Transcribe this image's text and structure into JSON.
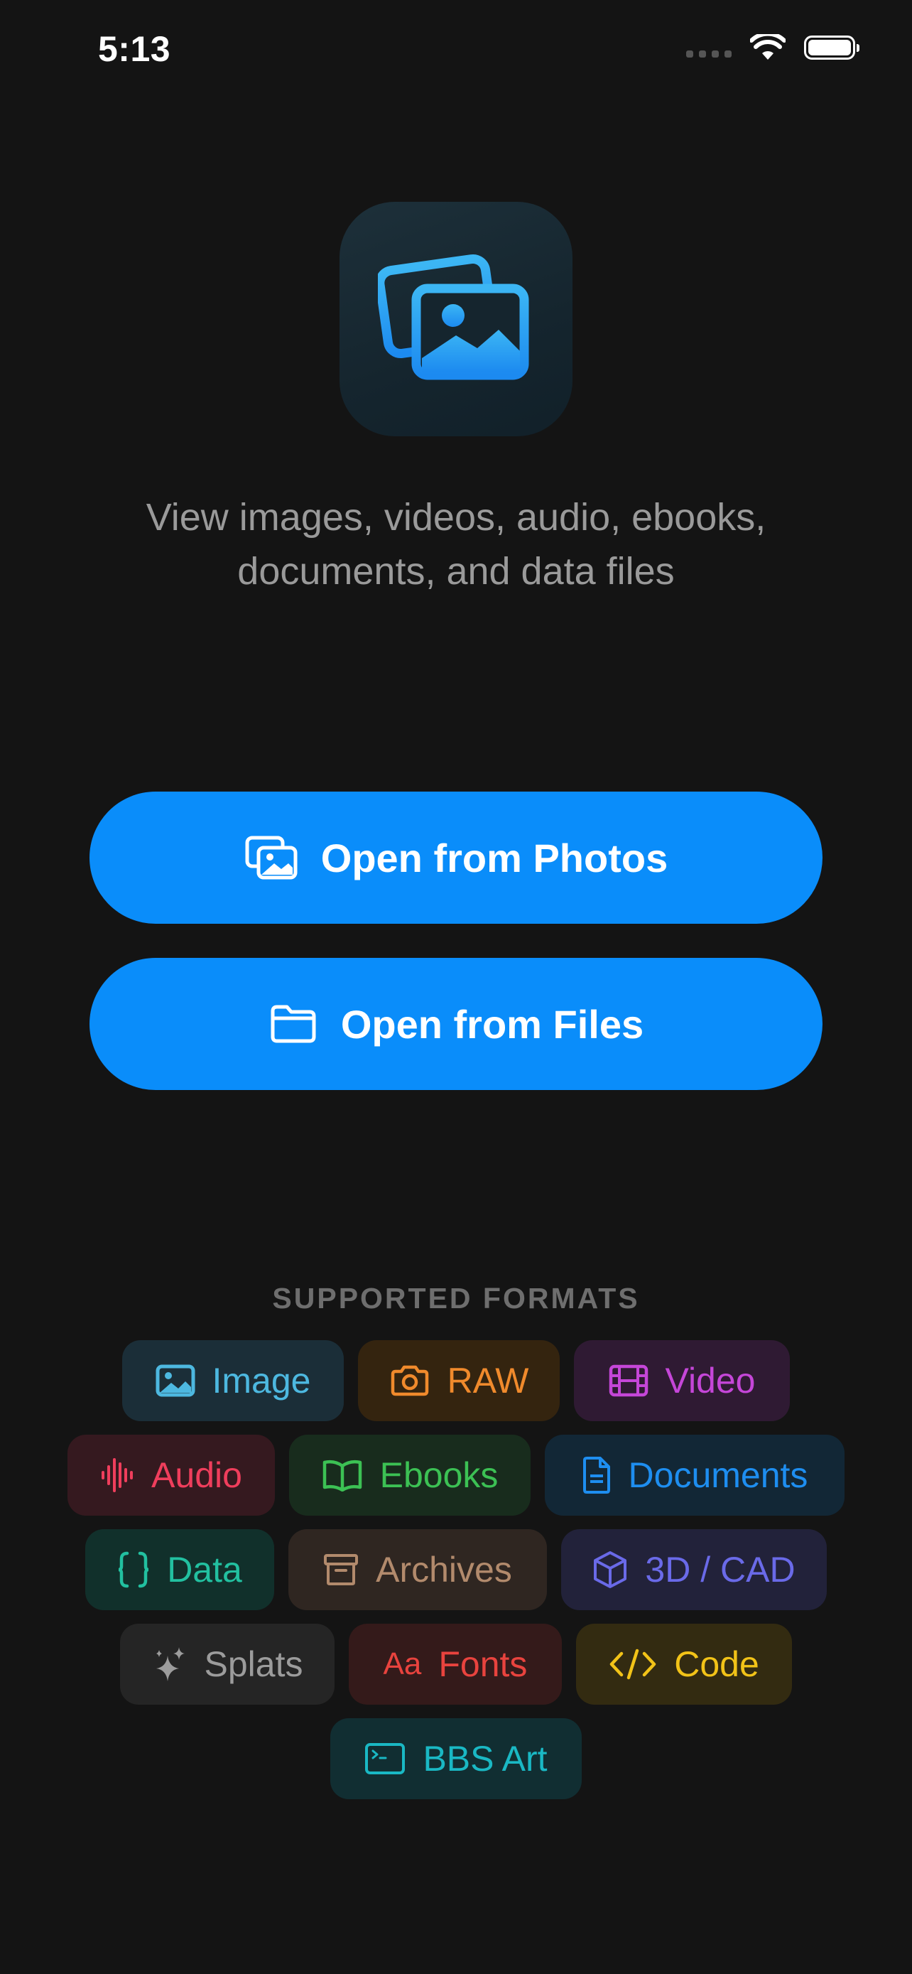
{
  "status_bar": {
    "time": "5:13"
  },
  "tagline": {
    "line1": "View images, videos, audio, ebooks,",
    "line2": "documents, and data files"
  },
  "buttons": {
    "photos_label": "Open from Photos",
    "files_label": "Open from Files",
    "color": "#0a8dfa"
  },
  "formats": {
    "title": "SUPPORTED FORMATS",
    "chips": [
      {
        "label": "Image",
        "icon": "image-icon",
        "color": "#4db8e0"
      },
      {
        "label": "RAW",
        "icon": "camera-icon",
        "color": "#f08a2c"
      },
      {
        "label": "Video",
        "icon": "film-icon",
        "color": "#c546d8"
      },
      {
        "label": "Audio",
        "icon": "waveform-icon",
        "color": "#ef3e5c"
      },
      {
        "label": "Ebooks",
        "icon": "book-icon",
        "color": "#3cc154"
      },
      {
        "label": "Documents",
        "icon": "document-icon",
        "color": "#1e8ef0"
      },
      {
        "label": "Data",
        "icon": "braces-icon",
        "color": "#22c0a0"
      },
      {
        "label": "Archives",
        "icon": "archive-box-icon",
        "color": "#b28a6c"
      },
      {
        "label": "3D / CAD",
        "icon": "cube-icon",
        "color": "#6a6ae8"
      },
      {
        "label": "Splats",
        "icon": "sparkles-icon",
        "color": "#9c9c9c"
      },
      {
        "label": "Fonts",
        "icon": "text-aa-icon",
        "color": "#e8433e"
      },
      {
        "label": "Code",
        "icon": "code-brackets-icon",
        "color": "#f2c318"
      },
      {
        "label": "BBS Art",
        "icon": "terminal-icon",
        "color": "#1ab8c4"
      }
    ]
  }
}
